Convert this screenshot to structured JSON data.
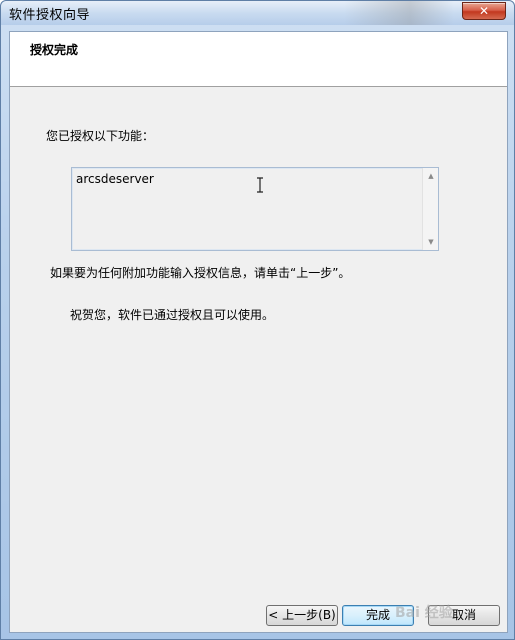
{
  "window": {
    "title": "软件授权向导",
    "close_glyph": "✕"
  },
  "header": {
    "title": "授权完成"
  },
  "main": {
    "label": "您已授权以下功能：",
    "features_text": "arcsdeserver",
    "info": "如果要为任何附加功能输入授权信息，请单击“上一步”。",
    "congrats": "祝贺您，软件已通过授权且可以使用。"
  },
  "buttons": {
    "back": "< 上一步(B)",
    "finish": "完成",
    "cancel": "取消"
  },
  "watermark": "Bai 经验",
  "icons": {
    "scroll_up": "scroll-up-arrow-icon",
    "scroll_down": "scroll-down-arrow-icon",
    "text_cursor": "ibeam-cursor-icon"
  }
}
